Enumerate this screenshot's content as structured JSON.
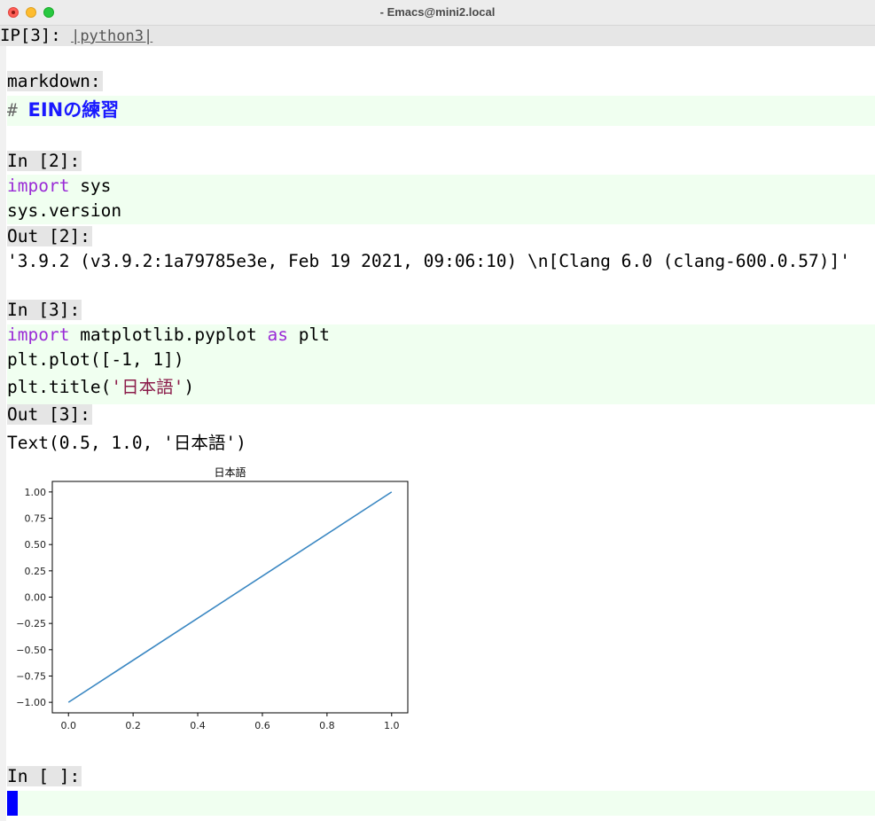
{
  "window": {
    "title": "- Emacs@mini2.local"
  },
  "header": {
    "prefix": "IP[3]: ",
    "kernel": "|python3|"
  },
  "cells": {
    "markdown": {
      "prompt": "markdown:",
      "hash": "#",
      "heading": "EINの練習"
    },
    "c2": {
      "prompt": "In [2]:",
      "kw1": "import",
      "rest1": " sys",
      "line2": "sys.version",
      "out_prompt": "Out [2]:",
      "output": "'3.9.2 (v3.9.2:1a79785e3e, Feb 19 2021, 09:06:10) \\n[Clang 6.0 (clang-600.0.57)]'"
    },
    "c3": {
      "prompt": "In [3]:",
      "kw1": "import",
      "mid1": " matplotlib.pyplot ",
      "kw2": "as",
      "rest1": " plt",
      "line2": "plt.plot([-1, 1])",
      "line3_pre": "plt.title(",
      "line3_str": "'日本語'",
      "line3_post": ")",
      "out_prompt": "Out [3]:",
      "output": "Text(0.5, 1.0, '日本語')"
    },
    "c4": {
      "prompt": "In [ ]:"
    }
  },
  "colors": {
    "keyword": "#9a2bd6",
    "string": "#8b1c4a",
    "heading": "#1a1aff",
    "cell_bg": "#f0fff0",
    "line": "#3a87c2",
    "cursor": "#0000ff"
  },
  "chart_data": {
    "type": "line",
    "title": "日本語",
    "x": [
      0.0,
      1.0
    ],
    "series": [
      {
        "values": [
          -1.0,
          1.0
        ]
      }
    ],
    "xlim": [
      -0.05,
      1.05
    ],
    "ylim": [
      -1.1,
      1.1
    ],
    "xticks": [
      "0.0",
      "0.2",
      "0.4",
      "0.6",
      "0.8",
      "1.0"
    ],
    "yticks": [
      "1.00",
      "0.75",
      "0.50",
      "0.25",
      "0.00",
      "−0.25",
      "−0.50",
      "−0.75",
      "−1.00"
    ],
    "grid": false
  }
}
